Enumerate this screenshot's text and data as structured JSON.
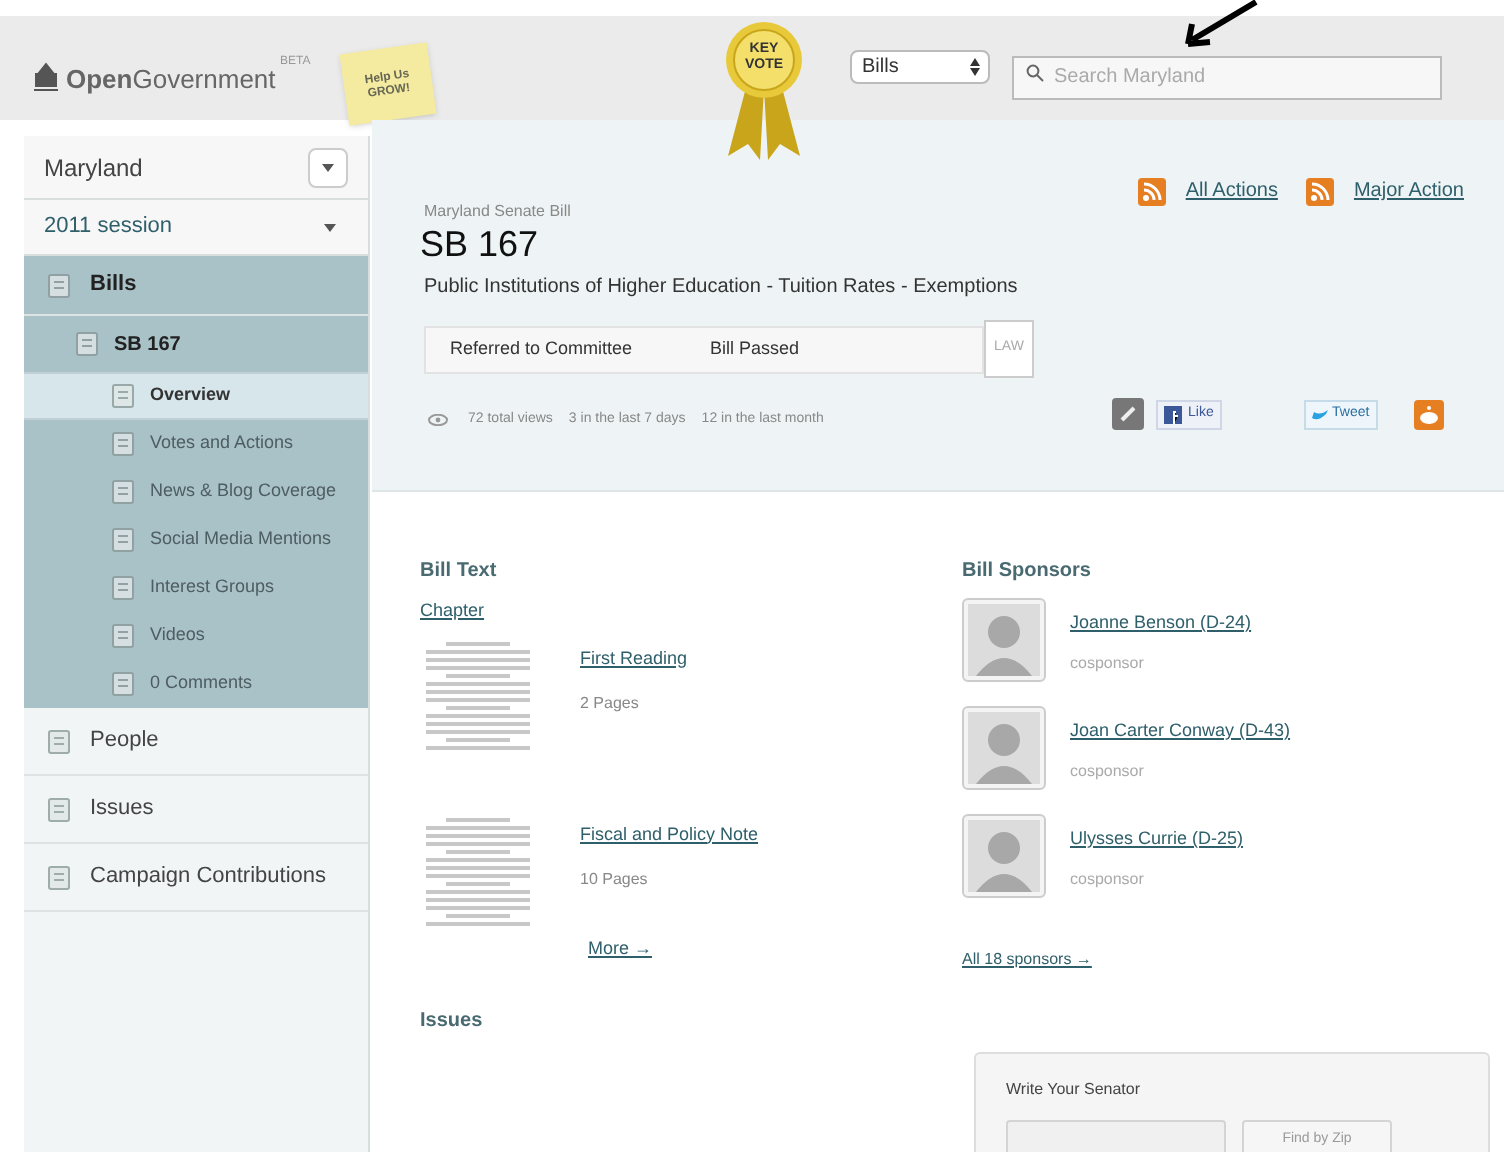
{
  "header": {
    "logo": "**Open**Government",
    "beta": "BETA",
    "note": "Help Us GROW!",
    "key_vote": "KEY VOTE",
    "type_select": "Bills",
    "search": {
      "placeholder": "Search Maryland"
    }
  },
  "sidebar": {
    "state_select": "Maryland",
    "session_select": "2011 session",
    "nav": [
      {
        "label": "Bills",
        "selected": true,
        "children": [
          {
            "label": "SB 167",
            "selected": true,
            "children": [
              {
                "label": "Overview",
                "selected": true
              },
              {
                "label": "Votes and Actions",
                "selected": false
              },
              {
                "label": "News & Blog Coverage",
                "selected": false
              },
              {
                "label": "Social Media Mentions",
                "selected": false
              },
              {
                "label": "Interest Groups",
                "selected": false
              },
              {
                "label": "Videos",
                "selected": false
              },
              {
                "label": "0 Comments",
                "selected": false
              }
            ]
          }
        ]
      },
      {
        "label": "People",
        "selected": false
      },
      {
        "label": "Issues",
        "selected": false
      },
      {
        "label": "Campaign Contributions",
        "selected": false
      }
    ]
  },
  "bill": {
    "feeds": [
      "All Actions",
      "Major Action"
    ],
    "type": "Maryland Senate Bill",
    "number": "SB 167",
    "title": "Public Institutions of Higher Education - Tuition Rates - Exemptions",
    "progress": [
      {
        "label": "Referred to Committee",
        "done": true
      },
      {
        "label": "Bill Passed",
        "done": true
      },
      {
        "label": "LAW",
        "done": false
      }
    ],
    "stats": [
      "72 total views",
      "3 in the last 7 days",
      "12 in the last month"
    ],
    "like": "Like",
    "tweet": "Tweet"
  },
  "bill_text": {
    "heading": "Bill Text",
    "chapter": "Chapter",
    "documents": [
      {
        "title": "First Reading",
        "pages": "2 Pages"
      },
      {
        "title": "Fiscal and Policy Note",
        "pages": "10 Pages"
      }
    ],
    "more": "More →"
  },
  "issues": {
    "heading": "Issues"
  },
  "sponsors": {
    "heading": "Bill Sponsors",
    "items": [
      {
        "name": "Joanne Benson (D-24)",
        "role": "cosponsor"
      },
      {
        "name": "Joan Carter Conway (D-43)",
        "role": "cosponsor"
      },
      {
        "name": "Ulysses Currie (D-25)",
        "role": "cosponsor"
      }
    ],
    "all": "All 18 sponsors →"
  },
  "write_senator": {
    "title": "Write Your Senator",
    "button": "Find by Zip"
  }
}
